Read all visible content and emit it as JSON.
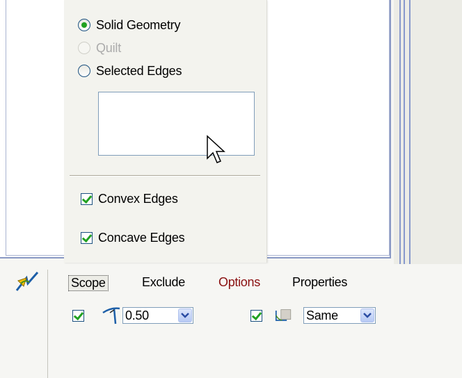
{
  "panel": {
    "radios": [
      {
        "label": "Solid Geometry",
        "checked": true,
        "disabled": false
      },
      {
        "label": "Quilt",
        "checked": false,
        "disabled": true
      },
      {
        "label": "Selected Edges",
        "checked": false,
        "disabled": false
      }
    ],
    "checkboxes": [
      {
        "label": "Convex Edges",
        "checked": true
      },
      {
        "label": "Concave Edges",
        "checked": true
      }
    ]
  },
  "dashboard": {
    "tabs": [
      {
        "label": "Scope",
        "active": true
      },
      {
        "label": "Exclude",
        "active": false
      },
      {
        "label": "Options",
        "active": false
      },
      {
        "label": "Properties",
        "active": false
      }
    ],
    "radius_value": "0.50",
    "transition_value": "Same"
  },
  "icons": {
    "feature": "round-feature-icon",
    "radius": "radius-icon",
    "transition": "transition-icon",
    "cursor": "mouse-pointer-icon",
    "dropdown": "chevron-down-icon"
  },
  "colors": {
    "check_green": "#21a121",
    "control_border": "#1c5180",
    "accent_blue": "#8899cc",
    "tab_red": "#8a1010"
  }
}
